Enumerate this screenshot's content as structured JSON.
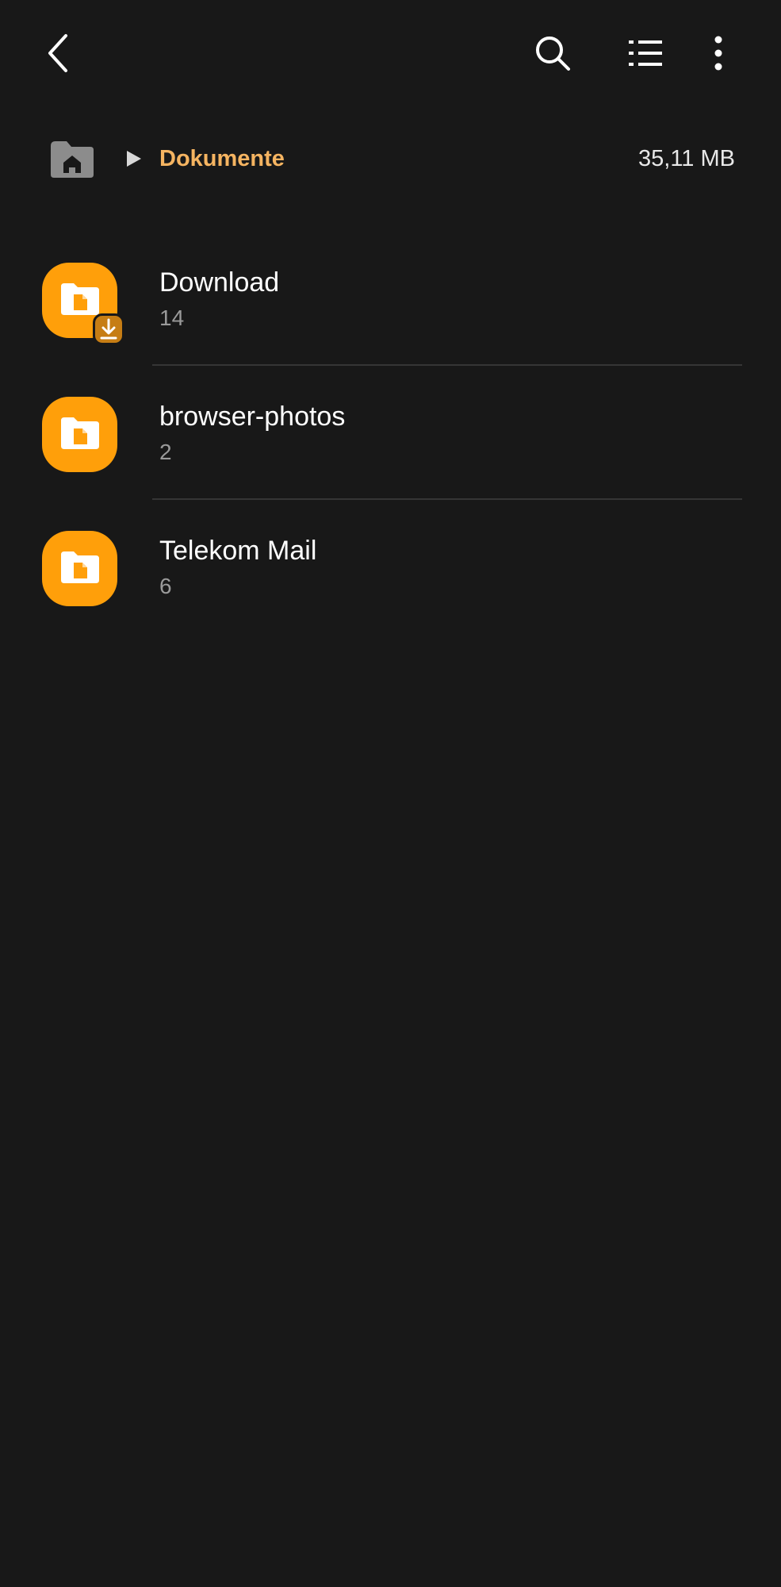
{
  "toolbar": {
    "back_icon": "chevron-left-icon",
    "search_icon": "search-icon",
    "view_icon": "list-view-icon",
    "more_icon": "more-vertical-icon"
  },
  "breadcrumb": {
    "home_icon": "home-folder-icon",
    "separator_icon": "play-arrow-icon",
    "current": "Dokumente",
    "size": "35,11 MB"
  },
  "folders": [
    {
      "name": "Download",
      "count": "14",
      "icon": "download-folder-icon"
    },
    {
      "name": "browser-photos",
      "count": "2",
      "icon": "folder-icon"
    },
    {
      "name": "Telekom Mail",
      "count": "6",
      "icon": "folder-icon"
    }
  ],
  "colors": {
    "background": "#181818",
    "accent": "#ff9f0a",
    "breadcrumb_text": "#f5b461",
    "secondary_text": "#9a9a9a",
    "divider": "#353535"
  }
}
